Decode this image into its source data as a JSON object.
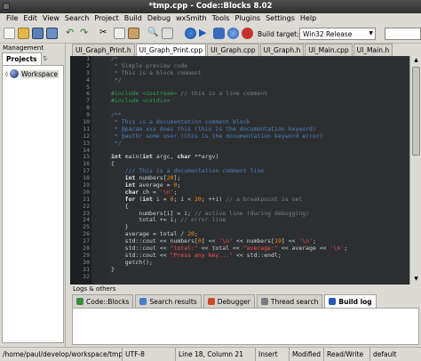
{
  "window": {
    "title": "*tmp.cpp - Code::Blocks 8.02"
  },
  "menu": [
    "File",
    "Edit",
    "View",
    "Search",
    "Project",
    "Build",
    "Debug",
    "wxSmith",
    "Tools",
    "Plugins",
    "Settings",
    "Help"
  ],
  "toolbar": {
    "build_target_label": "Build target:",
    "build_target_value": "Win32 Release",
    "icons": [
      "new-file-icon",
      "open-file-icon",
      "save-icon",
      "save-all-icon",
      "undo-icon",
      "redo-icon",
      "cut-icon",
      "copy-icon",
      "paste-icon",
      "find-icon",
      "replace-icon",
      "build-icon",
      "run-icon",
      "build-run-icon",
      "rebuild-icon",
      "abort-icon",
      "debug-icon"
    ]
  },
  "management": {
    "header": "Management",
    "tabs": [
      "Projects",
      "S"
    ],
    "tree_root": "Workspace"
  },
  "editor": {
    "tabs": [
      "UI_Graph_Print.h",
      "UI_Graph_Print.cpp",
      "UI_Graph.cpp",
      "UI_Graph.h",
      "UI_Main.cpp",
      "UI_Main.h"
    ],
    "active_tab": 1,
    "line_numbers": [
      "1",
      "2",
      "3",
      "4",
      "5",
      "6",
      "7",
      "8",
      "9",
      "10",
      "11",
      "12",
      "13",
      "14",
      "15",
      "16",
      "17",
      "18",
      "19",
      "20",
      "21",
      "22",
      "23",
      "24",
      "25",
      "26",
      "27",
      "28",
      "29",
      "30",
      "31",
      "32"
    ]
  },
  "code_lines": [
    "/*",
    " * Simple preview code",
    " * This is a block comment",
    " */",
    "",
    "#include <iostream> // this is a line comment",
    "#include <cstdio>",
    "",
    "/**",
    " * This is a documentation comment block",
    " * @param xxx does this (this is the documentation keyword)",
    " * @authr some user (this is the documentation keyword error)",
    " */",
    "",
    "int main(int argc, char **argv)",
    "{",
    "    /// This is a documentation comment line",
    "    int numbers[20];",
    "    int average = 0;",
    "    char ch = '\\n';",
    "    for (int i = 0; i < 20; ++i) // a breakpoint is set",
    "    {",
    "        numbers[i] = i; // active line (during debugging)",
    "        total += i; // error line",
    "    }",
    "    average = total / 20;",
    "    std::cout << numbers[0] << '\\n' << numbers[19] << '\\n';",
    "    std::cout << \"total:\" << total << \"average:\" << average << '\\n';",
    "    std::cout << \"Press any key...\" << std::endl;",
    "    getch();",
    "}",
    ""
  ],
  "bottom_panel": {
    "header": "Logs & others",
    "tabs": [
      {
        "label": "Code::Blocks",
        "icon": "codeblocks-icon"
      },
      {
        "label": "Search results",
        "icon": "search-icon"
      },
      {
        "label": "Debugger",
        "icon": "debugger-icon"
      },
      {
        "label": "Thread search",
        "icon": "thread-search-icon"
      },
      {
        "label": "Build log",
        "icon": "build-log-icon"
      }
    ],
    "active_tab": 4
  },
  "statusbar": {
    "path": "/home/paul/develop/workspace/tmp.cp",
    "encoding": "UTF-8",
    "position": "Line 18, Column 21",
    "mode": "Insert",
    "modified": "Modified",
    "access": "Read/Write",
    "profile": "default"
  },
  "colors": {
    "editor_bg": "#2c2e30",
    "gutter_bg": "#1d1f21",
    "comment": "#7a7d80",
    "doc_comment": "#4d7fbf",
    "preprocessor": "#2f9f4f",
    "string": "#ff4b4b",
    "number": "#ff8c00"
  }
}
